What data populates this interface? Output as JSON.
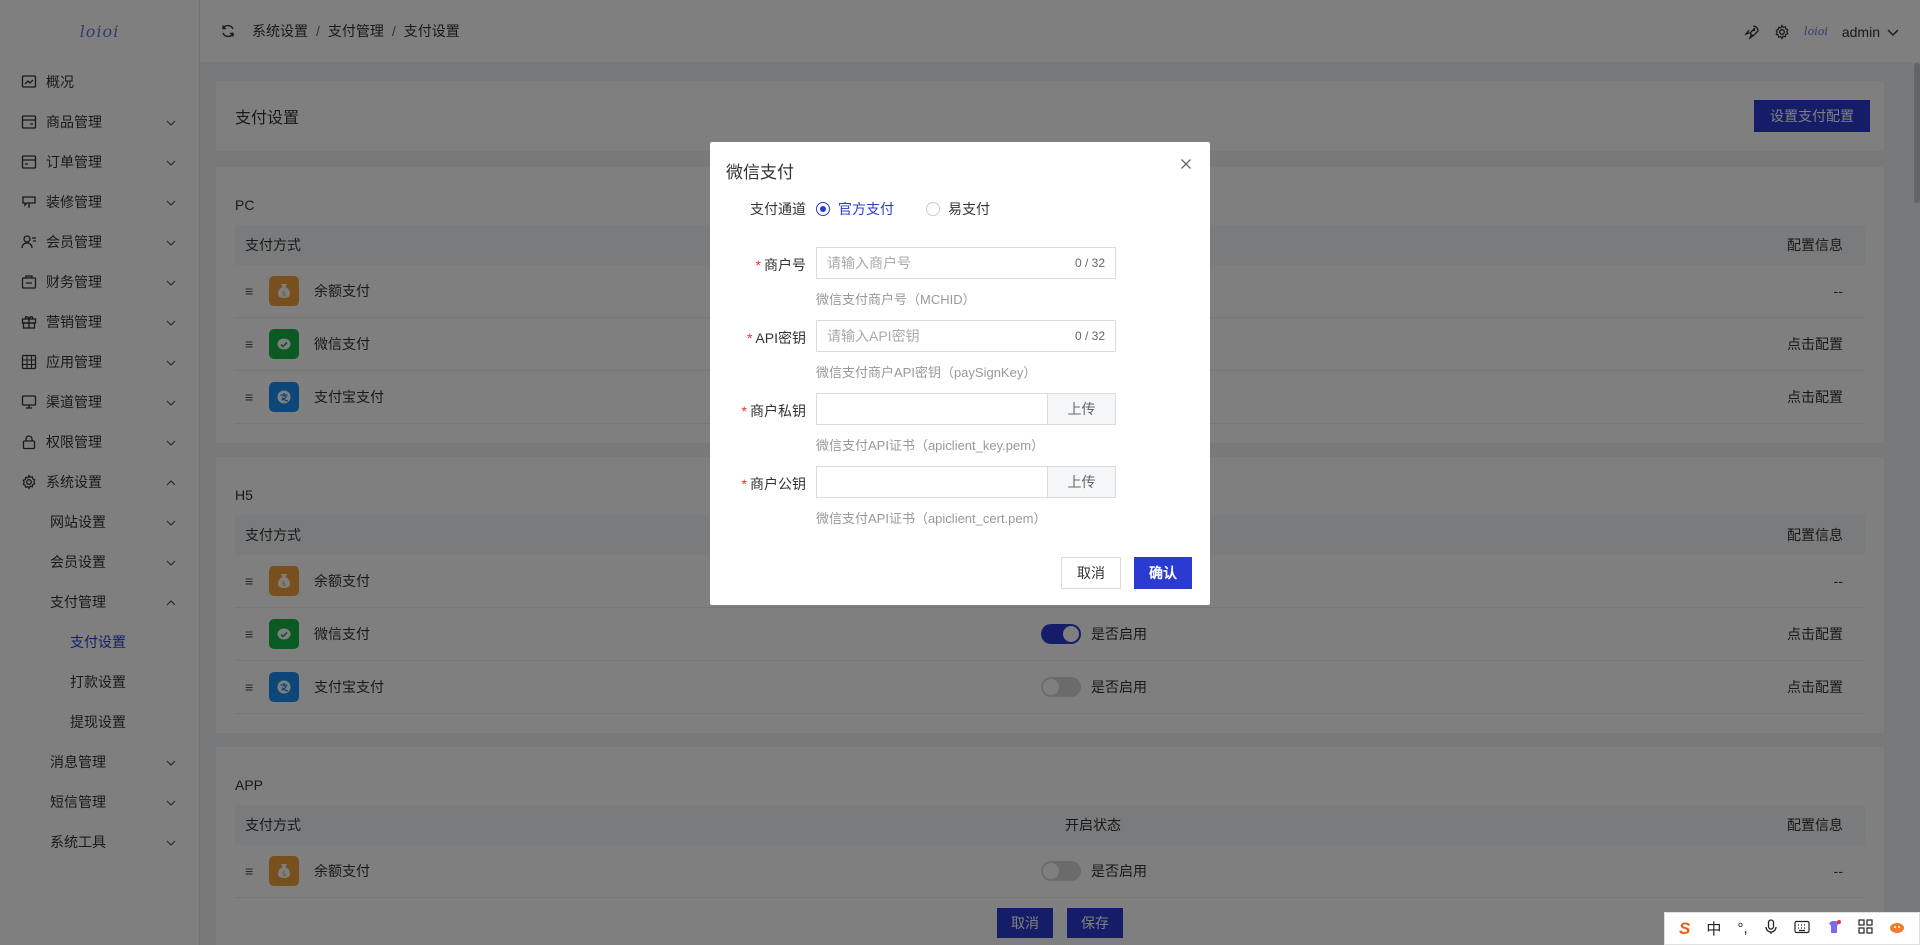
{
  "app": {
    "logo": "loioi"
  },
  "sidebar": {
    "items": [
      {
        "label": "概况",
        "icon": "dashboard-icon",
        "level": 0,
        "expandable": false
      },
      {
        "label": "商品管理",
        "icon": "goods-icon",
        "level": 0,
        "expandable": true
      },
      {
        "label": "订单管理",
        "icon": "order-icon",
        "level": 0,
        "expandable": true
      },
      {
        "label": "装修管理",
        "icon": "decorate-icon",
        "level": 0,
        "expandable": true
      },
      {
        "label": "会员管理",
        "icon": "member-icon",
        "level": 0,
        "expandable": true
      },
      {
        "label": "财务管理",
        "icon": "finance-icon",
        "level": 0,
        "expandable": true
      },
      {
        "label": "营销管理",
        "icon": "gift-icon",
        "level": 0,
        "expandable": true
      },
      {
        "label": "应用管理",
        "icon": "apps-icon",
        "level": 0,
        "expandable": true
      },
      {
        "label": "渠道管理",
        "icon": "monitor-icon",
        "level": 0,
        "expandable": true
      },
      {
        "label": "权限管理",
        "icon": "lock-icon",
        "level": 0,
        "expandable": true
      },
      {
        "label": "系统设置",
        "icon": "gear-icon",
        "level": 0,
        "expandable": true,
        "expanded": true
      },
      {
        "label": "网站设置",
        "level": 1,
        "expandable": true
      },
      {
        "label": "会员设置",
        "level": 1,
        "expandable": true
      },
      {
        "label": "支付管理",
        "level": 1,
        "expandable": true,
        "expanded": true
      },
      {
        "label": "支付设置",
        "level": 2,
        "active": true
      },
      {
        "label": "打款设置",
        "level": 2
      },
      {
        "label": "提现设置",
        "level": 2
      },
      {
        "label": "消息管理",
        "level": 1,
        "expandable": true
      },
      {
        "label": "短信管理",
        "level": 1,
        "expandable": true
      },
      {
        "label": "系统工具",
        "level": 1,
        "expandable": true
      }
    ]
  },
  "topbar": {
    "breadcrumb": [
      "系统设置",
      "支付管理",
      "支付设置"
    ],
    "user": "admin",
    "mini_logo": "loioi"
  },
  "page": {
    "title": "支付设置",
    "config_button": "设置支付配置",
    "sections": [
      {
        "title": "PC",
        "headers": [
          "支付方式",
          "",
          "配置信息"
        ],
        "rows": [
          {
            "name": "余额支付",
            "icon": "balance-icon",
            "config": "--"
          },
          {
            "name": "微信支付",
            "icon": "wechat-icon",
            "config": "点击配置"
          },
          {
            "name": "支付宝支付",
            "icon": "alipay-icon",
            "config": "点击配置"
          }
        ]
      },
      {
        "title": "H5",
        "headers": [
          "支付方式",
          "",
          "配置信息"
        ],
        "rows": [
          {
            "name": "余额支付",
            "icon": "balance-icon",
            "config": "--"
          },
          {
            "name": "微信支付",
            "icon": "wechat-icon",
            "enabled": true,
            "toggle_label": "是否启用",
            "config": "点击配置"
          },
          {
            "name": "支付宝支付",
            "icon": "alipay-icon",
            "enabled": false,
            "toggle_label": "是否启用",
            "config": "点击配置"
          }
        ]
      },
      {
        "title": "APP",
        "headers": [
          "支付方式",
          "开启状态",
          "配置信息"
        ],
        "rows": [
          {
            "name": "余额支付",
            "icon": "balance-icon",
            "enabled": false,
            "toggle_label": "是否启用",
            "config": "--"
          }
        ]
      }
    ],
    "footer": {
      "cancel": "取消",
      "save": "保存"
    }
  },
  "dialog": {
    "title": "微信支付",
    "channel": {
      "label": "支付通道",
      "options": [
        "官方支付",
        "易支付"
      ],
      "selected": "官方支付"
    },
    "merchant_id": {
      "label": "商户号",
      "placeholder": "请输入商户号",
      "counter": "0 / 32",
      "hint": "微信支付商户号（MCHID）"
    },
    "api_key": {
      "label": "API密钥",
      "placeholder": "请输入API密钥",
      "counter": "0 / 32",
      "hint": "微信支付商户API密钥（paySignKey）"
    },
    "private_key": {
      "label": "商户私钥",
      "upload": "上传",
      "hint": "微信支付API证书（apiclient_key.pem）"
    },
    "public_key": {
      "label": "商户公钥",
      "upload": "上传",
      "hint": "微信支付API证书（apiclient_cert.pem）"
    },
    "cancel": "取消",
    "confirm": "确认"
  },
  "ime": {
    "mode": "中"
  },
  "colors": {
    "primary": "#2b3bd1",
    "wechat": "#16b547",
    "alipay": "#1a8ef3",
    "balance": "#f0a13b",
    "required": "#e33333"
  }
}
